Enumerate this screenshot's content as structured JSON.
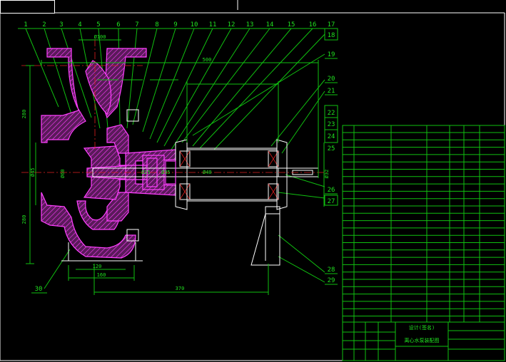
{
  "balloon_numbers": {
    "top_row": [
      "1",
      "2",
      "3",
      "4",
      "5",
      "6",
      "7",
      "8",
      "9",
      "10",
      "11",
      "12",
      "13",
      "14",
      "15",
      "16",
      "17"
    ],
    "right_column": [
      "18",
      "19",
      "20",
      "21",
      "22",
      "23",
      "24",
      "25",
      "26",
      "27",
      "28",
      "29"
    ],
    "bottom_left": "30"
  },
  "dimensions": {
    "overall_length": "500",
    "shaft_length": "370",
    "base_width": "160",
    "foot_width": "120",
    "height_upper": "280",
    "height_lower": "280",
    "top_flange": "Ø100",
    "shaft_end": "Ø32",
    "shaft_dims": [
      "Ø25",
      "Ø35",
      "Ø40",
      "Ø45",
      "Ø60"
    ]
  },
  "title_block": {
    "drawing_name": "离心水泵装配图",
    "label_small": "设计(签名)"
  },
  "colors": {
    "background": "#000000",
    "outline": "#ffffff",
    "dimension": "#10c010",
    "centerline": "#e02020",
    "section": "#ff40ff"
  }
}
